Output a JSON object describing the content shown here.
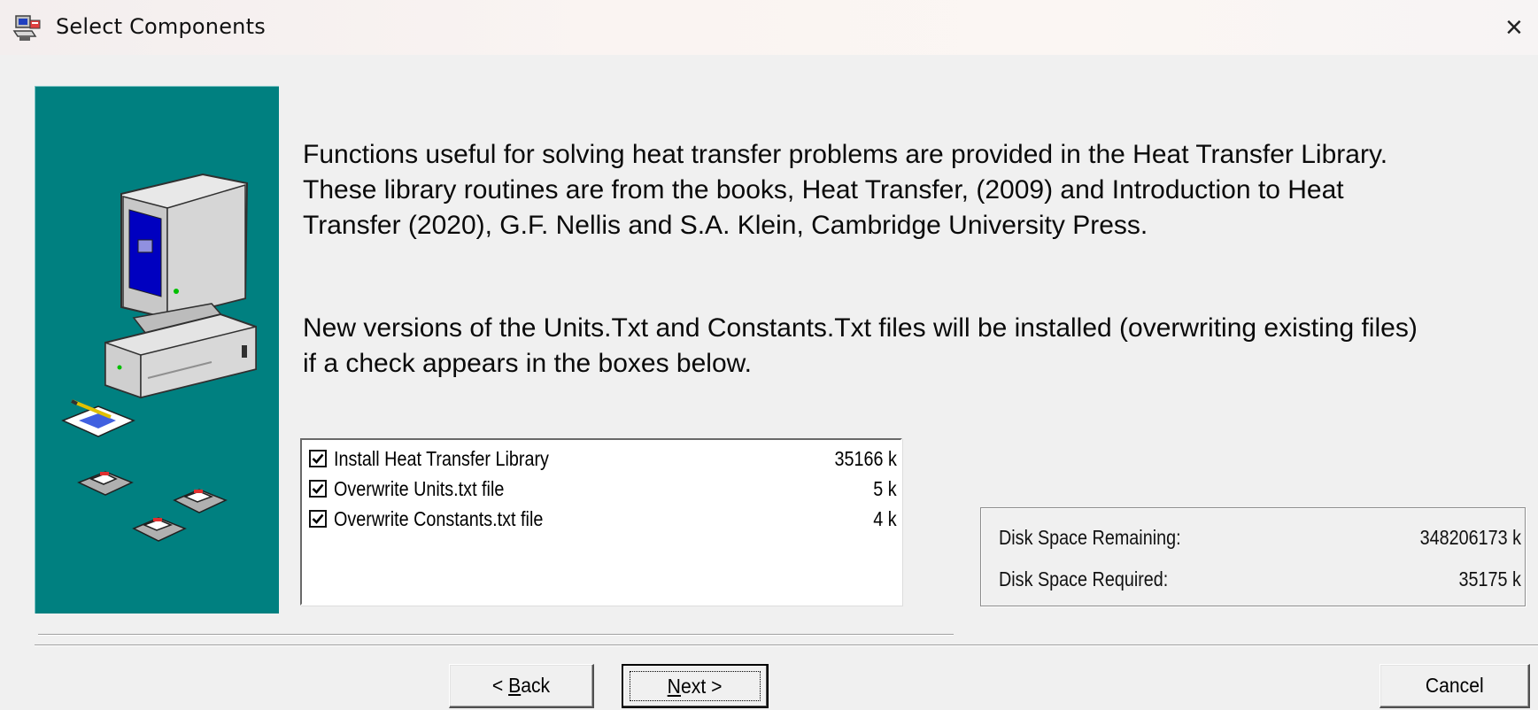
{
  "window": {
    "title": "Select Components",
    "close_glyph": "×",
    "title_icon": "setup-computer-icon"
  },
  "side_panel": {
    "background_color": "#008080",
    "illustration": "computer-with-disks-illustration"
  },
  "description": {
    "paragraph1": "Functions useful for solving heat transfer problems are provided in the Heat Transfer Library.\nThese library routines are from the books, Heat Transfer, (2009) and Introduction to Heat\nTransfer (2020), G.F. Nellis and S.A. Klein, Cambridge University Press.",
    "paragraph2": "New versions of the Units.Txt and Constants.Txt files will be installed  (overwriting existing files)\nif a check appears in the boxes below."
  },
  "components": [
    {
      "label": "Install Heat Transfer Library",
      "size": "35166 k",
      "checked": true
    },
    {
      "label": "Overwrite Units.txt file",
      "size": "5 k",
      "checked": true
    },
    {
      "label": "Overwrite Constants.txt file",
      "size": "4 k",
      "checked": true
    }
  ],
  "disk_space": {
    "remaining_label": "Disk Space Remaining:",
    "remaining_value": "348206173 k",
    "required_label": "Disk Space Required:",
    "required_value": "35175 k"
  },
  "buttons": {
    "back": {
      "prefix": "< ",
      "mnemonic": "B",
      "rest": "ack"
    },
    "next": {
      "mnemonic": "N",
      "rest": "ext >"
    },
    "cancel": "Cancel"
  }
}
